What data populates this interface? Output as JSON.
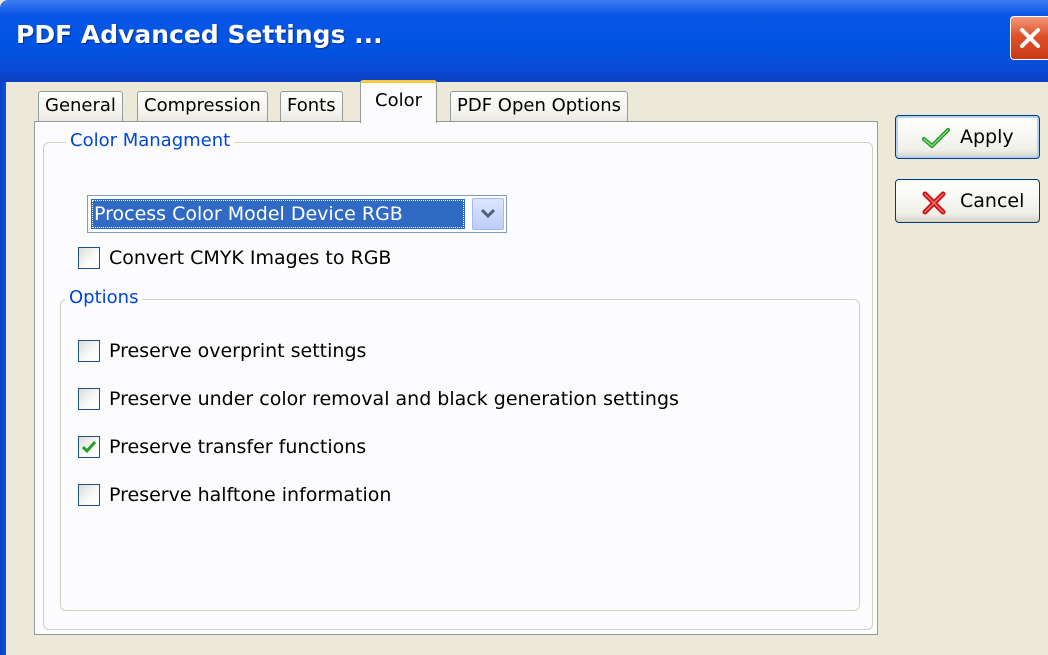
{
  "window": {
    "title": "PDF Advanced Settings ...",
    "accent_color": "#0054e3",
    "close_button_color": "#e0502a"
  },
  "tabs": [
    {
      "label": "General",
      "active": false
    },
    {
      "label": "Compression",
      "active": false
    },
    {
      "label": "Fonts",
      "active": false
    },
    {
      "label": "Color",
      "active": true
    },
    {
      "label": "PDF Open Options",
      "active": false
    }
  ],
  "color_management": {
    "legend": "Color Managment",
    "color_model": "Process Color Model Device RGB",
    "convert_cmyk": {
      "label": "Convert CMYK Images to RGB",
      "checked": false
    }
  },
  "options": {
    "legend": "Options",
    "items": [
      {
        "label": "Preserve overprint settings",
        "checked": false
      },
      {
        "label": "Preserve under color removal and black generation settings",
        "checked": false
      },
      {
        "label": "Preserve transfer functions",
        "checked": true
      },
      {
        "label": "Preserve halftone information",
        "checked": false
      }
    ]
  },
  "buttons": {
    "apply": {
      "label": "Apply",
      "icon": "green-checkmark-icon"
    },
    "cancel": {
      "label": "Cancel",
      "icon": "red-x-icon"
    }
  },
  "colors": {
    "group_legend": "#0046d5",
    "selection": "#316ac5",
    "check_mark": "#21a121",
    "active_tab_highlight": "#ffc83c"
  }
}
